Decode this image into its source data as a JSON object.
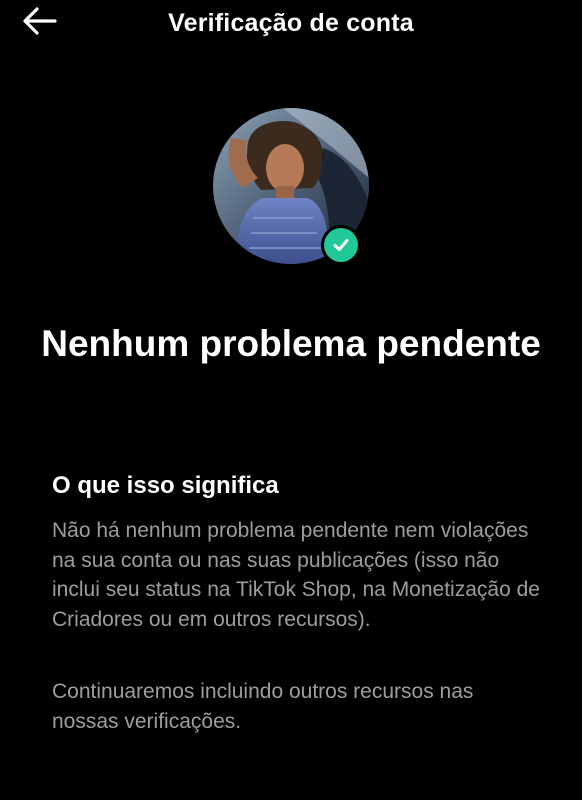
{
  "header": {
    "title": "Verificação de conta",
    "back_icon": "arrow-left-icon"
  },
  "profile": {
    "avatar_icon": "avatar",
    "badge_icon": "check-icon",
    "badge_color": "#20c997"
  },
  "status": {
    "title": "Nenhum problema pendente"
  },
  "info": {
    "heading": "O que isso significa",
    "paragraph_1": "Não há nenhum problema pendente nem violações na sua conta ou nas suas publicações (isso não inclui seu status na TikTok Shop, na Monetização de Criadores ou em outros recursos).",
    "paragraph_2": "Continuaremos incluindo outros recursos nas nossas verificações."
  },
  "colors": {
    "background": "#000000",
    "text_primary": "#ffffff",
    "text_secondary": "#9d9d9d",
    "accent": "#20c997"
  }
}
